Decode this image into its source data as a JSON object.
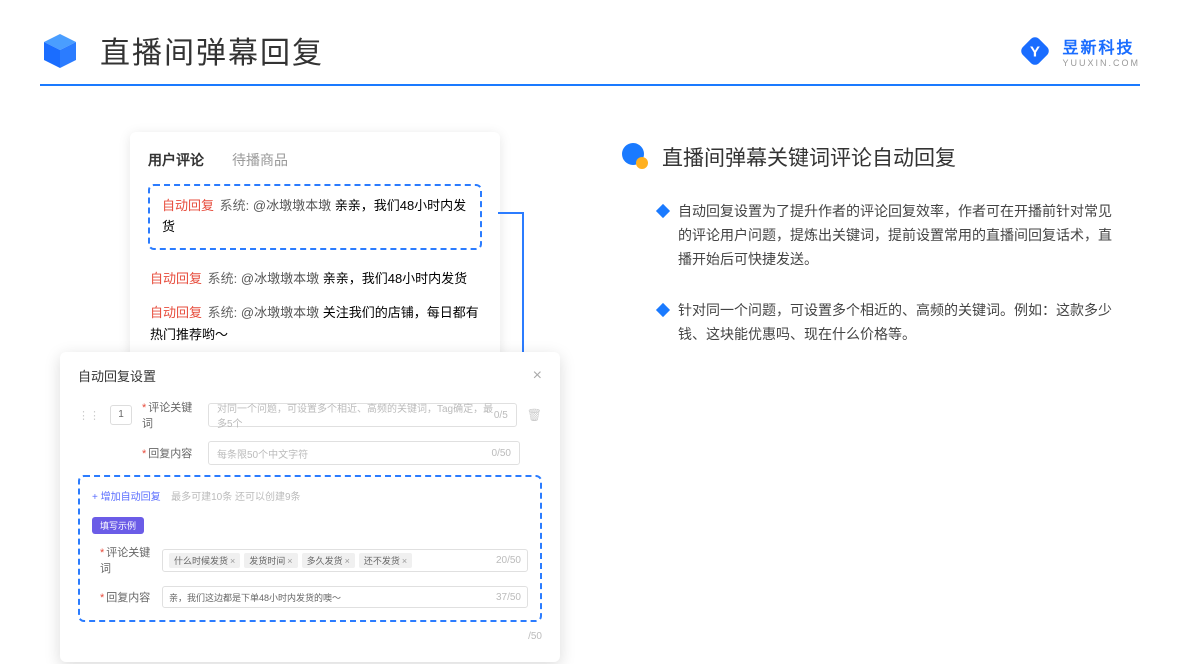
{
  "header": {
    "title": "直播间弹幕回复"
  },
  "brand": {
    "cn": "昱新科技",
    "en": "YUUXIN.COM"
  },
  "card1": {
    "tab_active": "用户评论",
    "tab_inactive": "待播商品",
    "msg1_badge": "自动回复",
    "msg1_sys": "系统:",
    "msg1_at": "@冰墩墩本墩",
    "msg1_txt": " 亲亲，我们48小时内发货",
    "msg2_badge": "自动回复",
    "msg2_sys": "系统:",
    "msg2_at": "@冰墩墩本墩",
    "msg2_txt": " 亲亲，我们48小时内发货",
    "msg3_badge": "自动回复",
    "msg3_sys": "系统:",
    "msg3_at": "@冰墩墩本墩",
    "msg3_txt": " 关注我们的店铺，每日都有热门推荐哟～"
  },
  "card2": {
    "title": "自动回复设置",
    "num": "1",
    "label_kw": "评论关键词",
    "kw_placeholder": "对同一个问题，可设置多个相近、高频的关键词，Tag确定，最多5个",
    "kw_counter": "0/5",
    "label_reply": "回复内容",
    "reply_placeholder": "每条限50个中文字符",
    "reply_counter": "0/50",
    "add_link": "+ 增加自动回复",
    "add_hint": "最多可建10条 还可以创建9条",
    "pill": "填写示例",
    "ex_label_kw": "评论关键词",
    "ex_tag1": "什么时候发货",
    "ex_tag2": "发货时间",
    "ex_tag3": "多久发货",
    "ex_tag4": "还不发货",
    "ex_kw_counter": "20/50",
    "ex_label_reply": "回复内容",
    "ex_reply": "亲，我们这边都是下单48小时内发货的噢～",
    "ex_reply_counter": "37/50",
    "outer_counter": "/50"
  },
  "right": {
    "section_title": "直播间弹幕关键词评论自动回复",
    "bullet1": "自动回复设置为了提升作者的评论回复效率，作者可在开播前针对常见的评论用户问题，提炼出关键词，提前设置常用的直播间回复话术，直播开始后可快捷发送。",
    "bullet2": "针对同一个问题，可设置多个相近的、高频的关键词。例如：这款多少钱、这块能优惠吗、现在什么价格等。"
  }
}
